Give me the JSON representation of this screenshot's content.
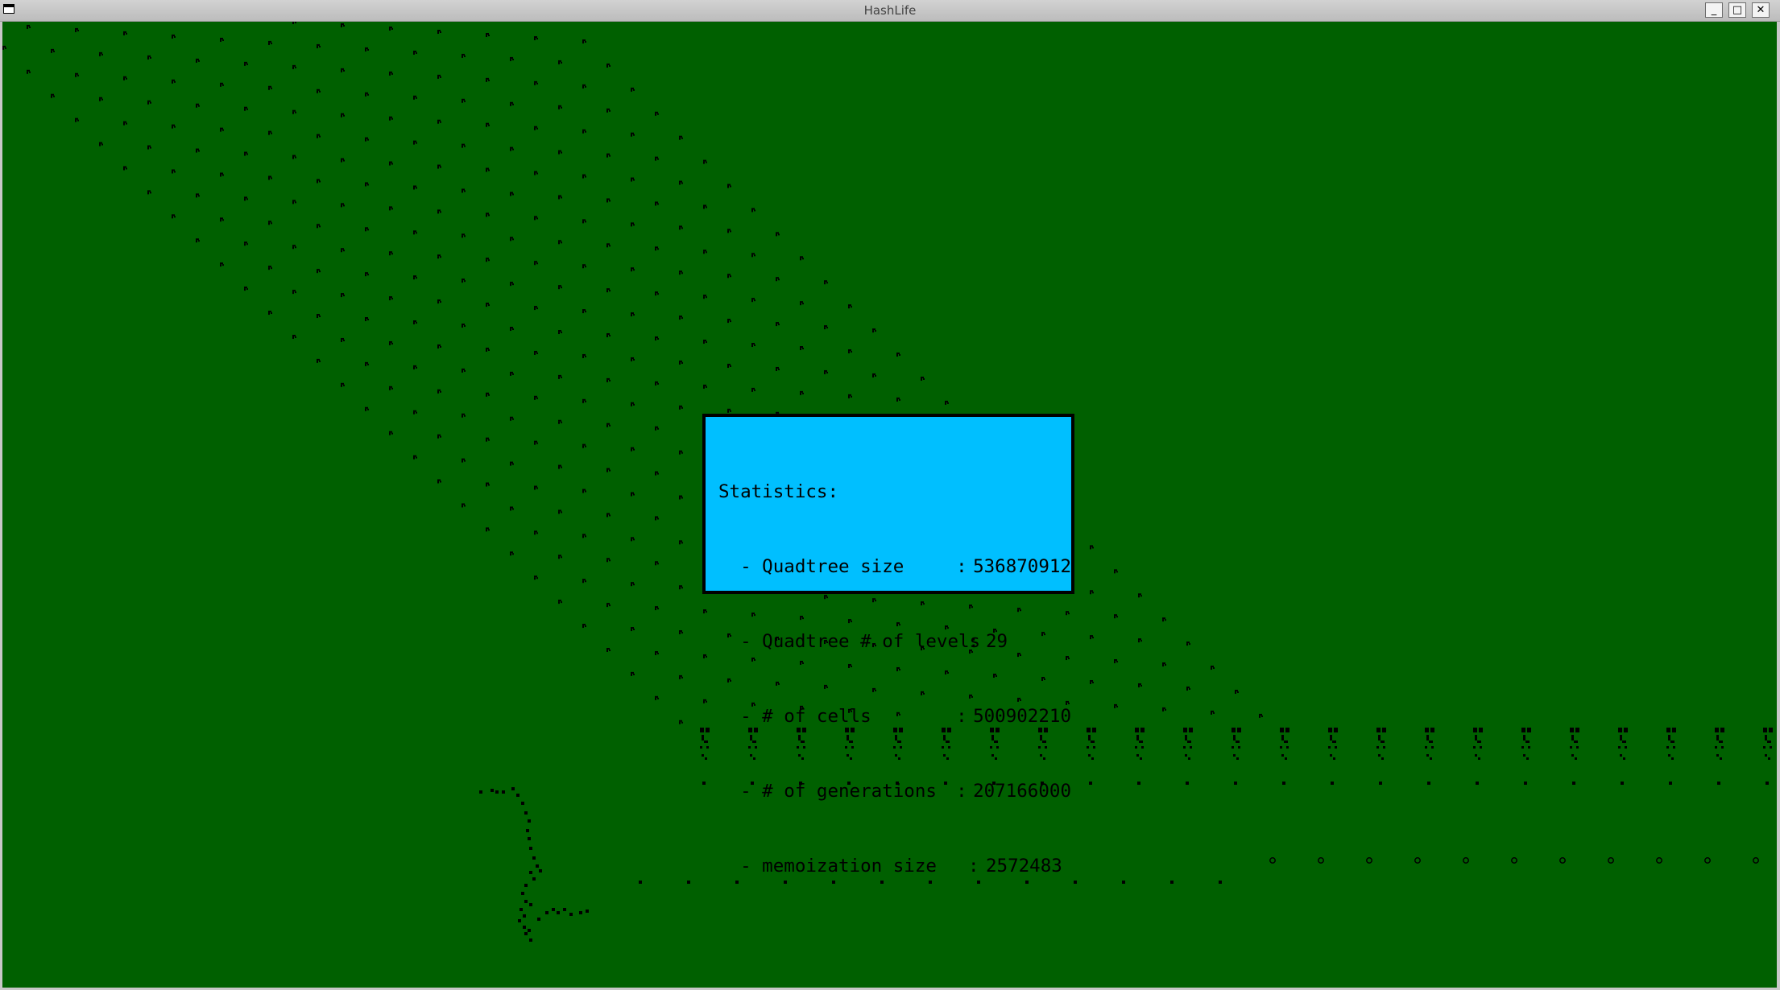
{
  "window": {
    "title": "HashLife",
    "buttons": {
      "minimize": "_",
      "maximize": "□",
      "close": "✕"
    }
  },
  "stats": {
    "heading": "Statistics:",
    "rows": [
      {
        "label": "  - Quadtree size",
        "value": "536870912"
      },
      {
        "label": "  - Quadtree # of levels",
        "value": "29"
      },
      {
        "label": "  - # of cells",
        "value": "500902210"
      },
      {
        "label": "  - # of generations",
        "value": "207166000"
      },
      {
        "label": "  - memoization size",
        "value": "2572483"
      }
    ]
  },
  "colors": {
    "background": "#006000",
    "cells": "#000000",
    "panel": "#00bfff"
  }
}
